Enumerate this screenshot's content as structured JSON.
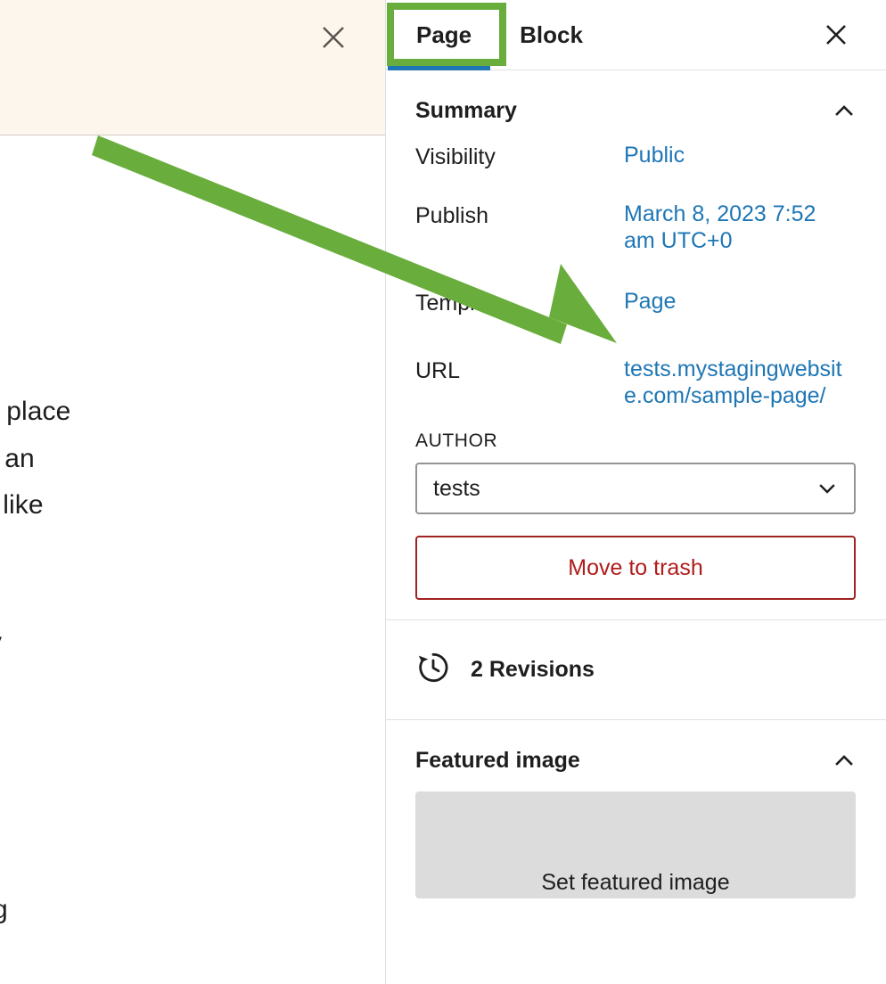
{
  "editor": {
    "notice": {
      "dismiss_icon": "close-icon"
    },
    "document_text_fragments": [
      "e place",
      "n an",
      "g like",
      "y",
      "g"
    ]
  },
  "annotation": {
    "color": "#69ad3c",
    "highlight_target": "Page",
    "arrow_points_to": "Page"
  },
  "sidebar": {
    "tabs": [
      {
        "label": "Page",
        "selected": true
      },
      {
        "label": "Block",
        "selected": false
      }
    ],
    "close_icon": "close-icon",
    "summary": {
      "title": "Summary",
      "collapse_icon": "chevron-up-icon",
      "rows": [
        {
          "label": "Visibility",
          "value": "Public"
        },
        {
          "label": "Publish",
          "value": "March 8, 2023 7:52 am UTC+0"
        },
        {
          "label": "Template",
          "value": "Page"
        },
        {
          "label": "URL",
          "value": "tests.mystagingwebsite.com/sample-page/"
        }
      ],
      "author": {
        "label": "AUTHOR",
        "value": "tests",
        "chevron_icon": "chevron-down-icon"
      },
      "trash_button": "Move to trash"
    },
    "revisions": {
      "icon": "history-icon",
      "label": "2 Revisions"
    },
    "featured_image": {
      "title": "Featured image",
      "collapse_icon": "chevron-up-icon",
      "placeholder_label": "Set featured image"
    }
  },
  "colors": {
    "accent_blue": "#1e76b5",
    "annotation_green": "#69ad3c",
    "danger_red": "#b01c1c",
    "notice_bg": "#fdf6ed",
    "placeholder_gray": "#dcdcdc"
  }
}
